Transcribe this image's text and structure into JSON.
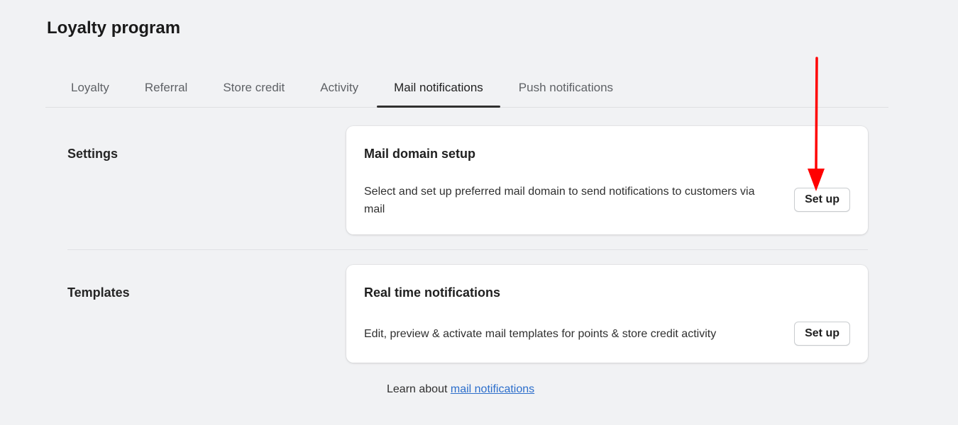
{
  "page_title": "Loyalty program",
  "tabs": [
    {
      "label": "Loyalty",
      "active": false
    },
    {
      "label": "Referral",
      "active": false
    },
    {
      "label": "Store credit",
      "active": false
    },
    {
      "label": "Activity",
      "active": false
    },
    {
      "label": "Mail notifications",
      "active": true
    },
    {
      "label": "Push notifications",
      "active": false
    }
  ],
  "sections": {
    "settings": {
      "label": "Settings",
      "card_title": "Mail domain setup",
      "card_description": "Select and set up preferred mail domain to send notifications to customers via mail",
      "button_label": "Set up"
    },
    "templates": {
      "label": "Templates",
      "card_title": "Real time notifications",
      "card_description": "Edit, preview & activate mail templates for points & store credit activity",
      "button_label": "Set up"
    }
  },
  "footer": {
    "prefix": "Learn about",
    "link_text": "mail notifications"
  },
  "colors": {
    "background": "#f1f2f4",
    "link": "#2c6ecb",
    "annotation_arrow": "#ff0000"
  }
}
